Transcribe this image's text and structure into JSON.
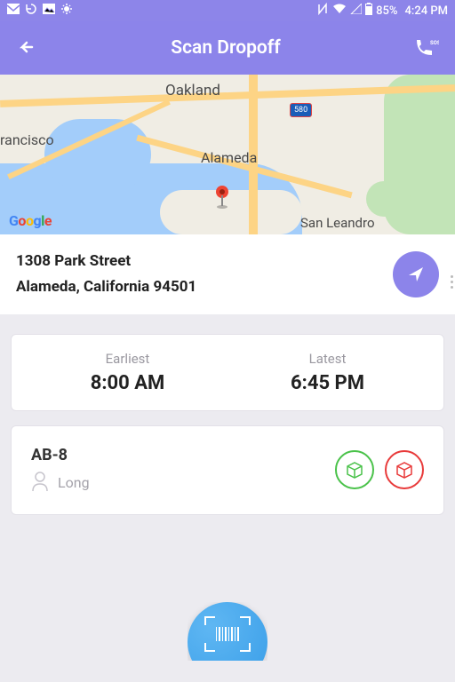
{
  "status": {
    "battery": "85%",
    "time": "4:24 PM"
  },
  "header": {
    "title": "Scan Dropoff"
  },
  "map": {
    "cities": {
      "oakland": "Oakland",
      "alameda": "Alameda",
      "sf": "rancisco",
      "sanleandro": "San Leandro"
    },
    "shield": "580"
  },
  "address": {
    "line1": "1308 Park Street",
    "line2": "Alameda, California 94501"
  },
  "timewindow": {
    "earliest_label": "Earliest",
    "earliest_value": "8:00 AM",
    "latest_label": "Latest",
    "latest_value": "6:45 PM"
  },
  "package": {
    "id": "AB-8",
    "name": "Long"
  }
}
